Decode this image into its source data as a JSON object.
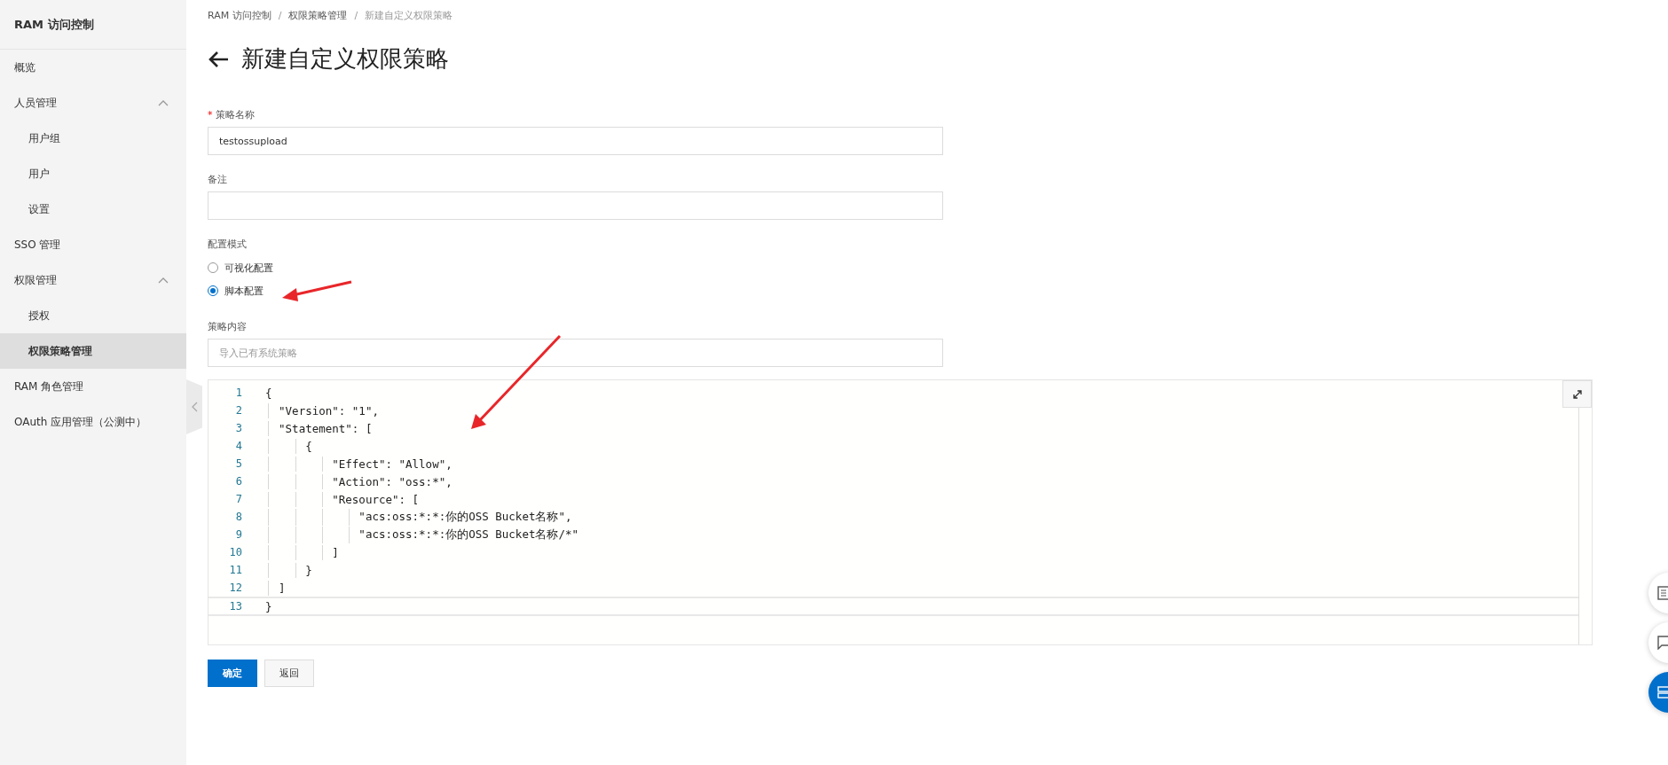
{
  "sidebar": {
    "title": "RAM 访问控制",
    "items": [
      {
        "label": "概览",
        "selected": false
      },
      {
        "label": "人员管理",
        "selected": false,
        "expanded": true,
        "children": [
          {
            "label": "用户组",
            "selected": false
          },
          {
            "label": "用户",
            "selected": false
          },
          {
            "label": "设置",
            "selected": false
          }
        ]
      },
      {
        "label": "SSO 管理",
        "selected": false
      },
      {
        "label": "权限管理",
        "selected": false,
        "expanded": true,
        "children": [
          {
            "label": "授权",
            "selected": false
          },
          {
            "label": "权限策略管理",
            "selected": true
          }
        ]
      },
      {
        "label": "RAM 角色管理",
        "selected": false
      },
      {
        "label": "OAuth 应用管理（公测中）",
        "selected": false
      }
    ]
  },
  "breadcrumb": [
    {
      "kind": "link",
      "text": "RAM 访问控制"
    },
    {
      "kind": "separator",
      "text": "/"
    },
    {
      "kind": "link",
      "text": "权限策略管理"
    },
    {
      "kind": "separator",
      "text": "/"
    },
    {
      "kind": "current",
      "text": "新建自定义权限策略"
    }
  ],
  "page_title": "新建自定义权限策略",
  "form": {
    "name_field": {
      "label": "策略名称",
      "required_mark": "*",
      "value": "testossupload"
    },
    "note_field": {
      "label": "备注"
    },
    "mode": {
      "label": "配置模式",
      "options": [
        {
          "label": "可视化配置",
          "selected": false
        },
        {
          "label": "脚本配置",
          "selected": true
        }
      ]
    },
    "content": {
      "label": "策略内容",
      "placeholder": "导入已有系统策略"
    }
  },
  "editor": {
    "lines": [
      {
        "number": "1",
        "text": "{",
        "active": false
      },
      {
        "number": "2",
        "text": "  \"Version\": \"1\",",
        "active": false
      },
      {
        "number": "3",
        "text": "  \"Statement\": [",
        "active": false
      },
      {
        "number": "4",
        "text": "      {",
        "active": false
      },
      {
        "number": "5",
        "text": "          \"Effect\": \"Allow\",",
        "active": false
      },
      {
        "number": "6",
        "text": "          \"Action\": \"oss:*\",",
        "active": false
      },
      {
        "number": "7",
        "text": "          \"Resource\": [",
        "active": false
      },
      {
        "number": "8",
        "text": "              \"acs:oss:*:*:你的OSS Bucket名称\",",
        "active": false
      },
      {
        "number": "9",
        "text": "              \"acs:oss:*:*:你的OSS Bucket名称/*\"",
        "active": false
      },
      {
        "number": "10",
        "text": "          ]",
        "active": false
      },
      {
        "number": "11",
        "text": "      }",
        "active": false
      },
      {
        "number": "12",
        "text": "  ]",
        "active": false
      },
      {
        "number": "13",
        "text": "}",
        "active": true
      }
    ]
  },
  "buttons": [
    {
      "label": "确定",
      "kind": "primary"
    },
    {
      "label": "返回",
      "kind": "secondary"
    }
  ]
}
